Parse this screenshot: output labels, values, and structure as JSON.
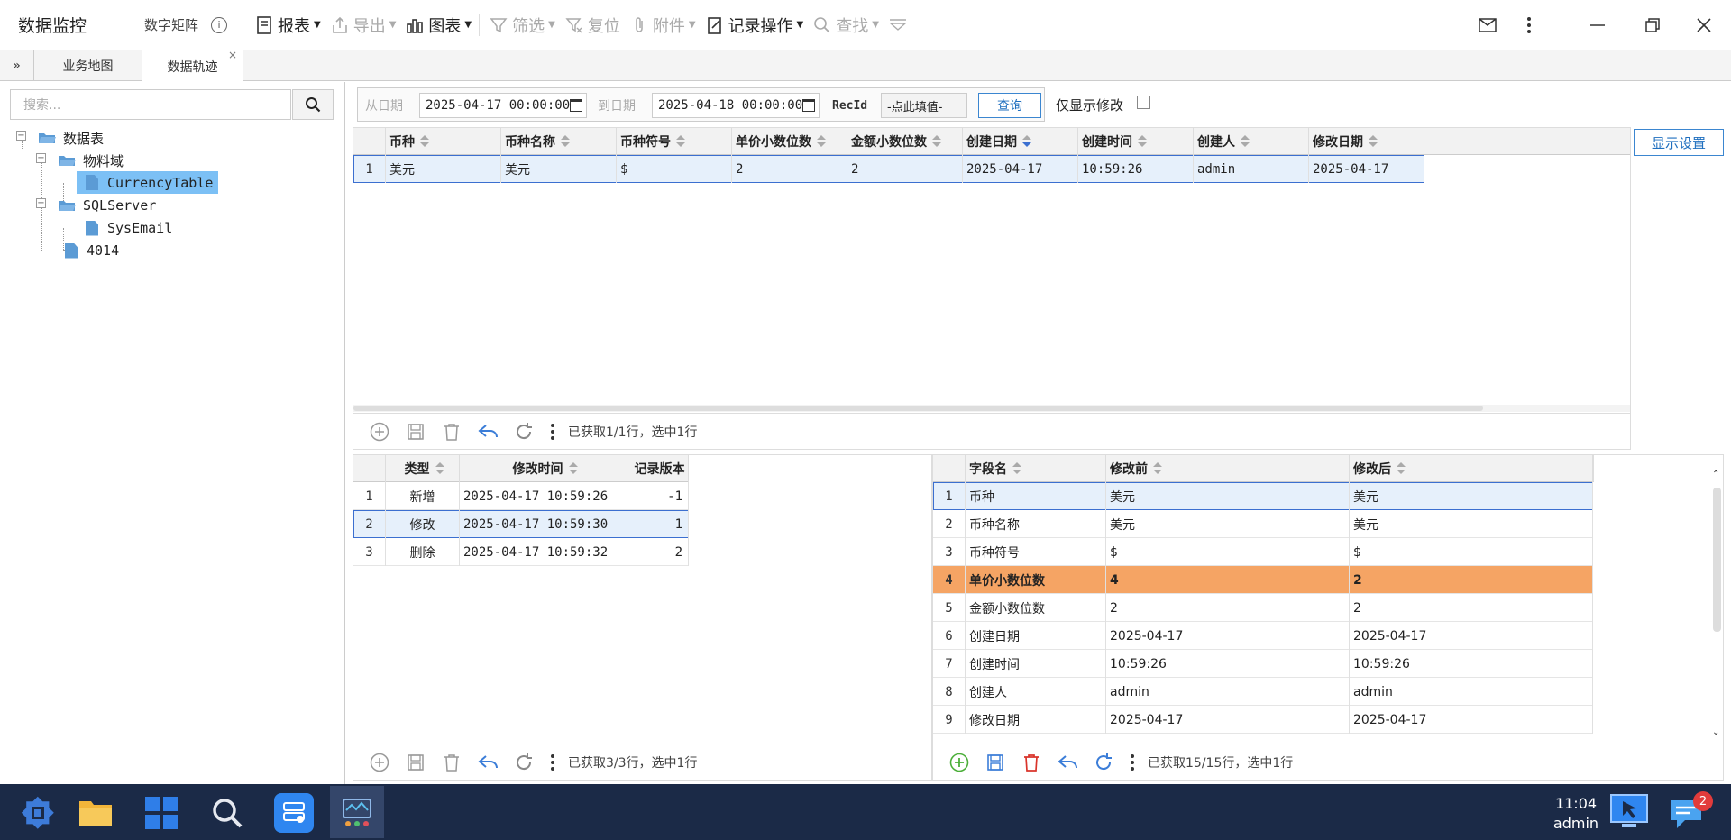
{
  "app": {
    "title": "数据监控",
    "subtitle": "数字矩阵",
    "info_icon": "info-icon"
  },
  "toolbar": [
    {
      "label": "报表",
      "icon": "report-icon",
      "caret": true,
      "disabled": false
    },
    {
      "label": "导出",
      "icon": "export-icon",
      "caret": true,
      "disabled": true
    },
    {
      "label": "图表",
      "icon": "chart-icon",
      "caret": true,
      "disabled": false
    },
    {
      "label": "筛选",
      "icon": "filter-icon",
      "caret": true,
      "disabled": true
    },
    {
      "label": "复位",
      "icon": "filter-reset-icon",
      "caret": false,
      "disabled": true
    },
    {
      "label": "附件",
      "icon": "attachment-icon",
      "caret": true,
      "disabled": true
    },
    {
      "label": "记录操作",
      "icon": "record-icon",
      "caret": true,
      "disabled": false
    },
    {
      "label": "查找",
      "icon": "search-icon",
      "caret": true,
      "disabled": true
    }
  ],
  "tabs": [
    {
      "label": "业务地图"
    },
    {
      "label": "数据轨迹"
    }
  ],
  "sidebar": {
    "search_placeholder": "搜索...",
    "tree": [
      {
        "label": "数据表",
        "level": 0,
        "type": "folder"
      },
      {
        "label": "物料域",
        "level": 1,
        "type": "folder"
      },
      {
        "label": "CurrencyTable",
        "level": 2,
        "type": "file",
        "selected": true
      },
      {
        "label": "SQLServer",
        "level": 1,
        "type": "folder"
      },
      {
        "label": "SysEmail",
        "level": 2,
        "type": "file"
      },
      {
        "label": "4014",
        "level": 1,
        "type": "file"
      }
    ]
  },
  "filter": {
    "from_label": "从日期",
    "from_value": "2025-04-17 00:00:00",
    "to_label": "到日期",
    "to_value": "2025-04-18 00:00:00",
    "recid_label": "RecId",
    "recid_value": "-点此填值-",
    "query_label": "查询",
    "only_modified_label": "仅显示修改",
    "display_settings_label": "显示设置"
  },
  "main_grid": {
    "columns": [
      "币种",
      "币种名称",
      "币种符号",
      "单价小数位数",
      "金额小数位数",
      "创建日期",
      "创建时间",
      "创建人",
      "修改日期"
    ],
    "rows": [
      [
        "1",
        "美元",
        "美元",
        "$",
        "2",
        "2",
        "2025-04-17",
        "10:59:26",
        "admin",
        "2025-04-17"
      ]
    ],
    "status": "已获取1/1行，选中1行"
  },
  "history_grid": {
    "columns": [
      "类型",
      "修改时间",
      "记录版本"
    ],
    "rows": [
      [
        "1",
        "新增",
        "2025-04-17 10:59:26",
        "-1"
      ],
      [
        "2",
        "修改",
        "2025-04-17 10:59:30",
        "1"
      ],
      [
        "3",
        "删除",
        "2025-04-17 10:59:32",
        "2"
      ]
    ],
    "status": "已获取3/3行，选中1行"
  },
  "diff_grid": {
    "columns": [
      "字段名",
      "修改前",
      "修改后"
    ],
    "rows": [
      [
        "1",
        "币种",
        "美元",
        "美元"
      ],
      [
        "2",
        "币种名称",
        "美元",
        "美元"
      ],
      [
        "3",
        "币种符号",
        "$",
        "$"
      ],
      [
        "4",
        "单价小数位数",
        "4",
        "2"
      ],
      [
        "5",
        "金额小数位数",
        "2",
        "2"
      ],
      [
        "6",
        "创建日期",
        "2025-04-17",
        "2025-04-17"
      ],
      [
        "7",
        "创建时间",
        "10:59:26",
        "10:59:26"
      ],
      [
        "8",
        "创建人",
        "admin",
        "admin"
      ],
      [
        "9",
        "修改日期",
        "2025-04-17",
        "2025-04-17"
      ]
    ],
    "status": "已获取15/15行，选中1行"
  },
  "taskbar": {
    "time": "11:04",
    "user": "admin",
    "badge": "2"
  },
  "colors": {
    "accent": "#3b6fd0",
    "highlight": "#f5a464",
    "taskbar": "#1b2a47"
  }
}
